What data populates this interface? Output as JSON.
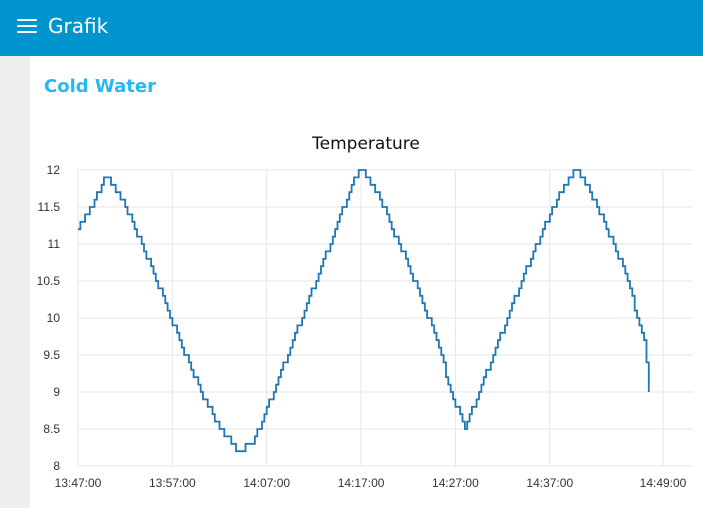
{
  "header": {
    "title": "Grafik",
    "menu_icon": "hamburger-menu-icon",
    "background_color": "#0094ce"
  },
  "group": {
    "title": "Cold Water",
    "title_color": "#29b6f6"
  },
  "chart_data": {
    "type": "line",
    "title": "Temperature",
    "xlabel": "",
    "ylabel": "",
    "xlim": [
      "13:47:00",
      "14:49:00"
    ],
    "ylim": [
      8,
      12
    ],
    "yticks": [
      "12",
      "11.5",
      "11",
      "10.5",
      "10",
      "9.5",
      "9",
      "8.5",
      "8"
    ],
    "xticks": [
      "13:47:00",
      "13:57:00",
      "14:07:00",
      "14:17:00",
      "14:27:00",
      "14:37:00",
      "14:49:00"
    ],
    "grid": true,
    "line_color": "#1f77b4",
    "series": [
      {
        "x": [
          "13:47:00",
          "13:48:30",
          "13:49:30",
          "13:50:00",
          "13:52:00",
          "13:55:00",
          "13:58:00",
          "14:00:00",
          "14:02:00",
          "14:04:00",
          "14:05:30",
          "14:08:00",
          "14:11:00",
          "14:14:00",
          "14:16:00",
          "14:17:00",
          "14:19:00",
          "14:22:00",
          "14:25:00",
          "14:26:30",
          "14:28:00",
          "14:31:00",
          "14:34:00",
          "14:37:00",
          "14:39:00",
          "14:40:00",
          "14:42:00",
          "14:45:00",
          "14:47:00",
          "14:47:30"
        ],
        "y": [
          11.2,
          11.5,
          11.8,
          11.9,
          11.5,
          10.6,
          9.6,
          9.0,
          8.5,
          8.2,
          8.3,
          9.1,
          10.1,
          11.1,
          11.8,
          12.0,
          11.6,
          10.7,
          9.7,
          9.0,
          8.5,
          9.5,
          10.5,
          11.4,
          11.9,
          12.0,
          11.5,
          10.6,
          9.7,
          9.0
        ]
      }
    ]
  }
}
